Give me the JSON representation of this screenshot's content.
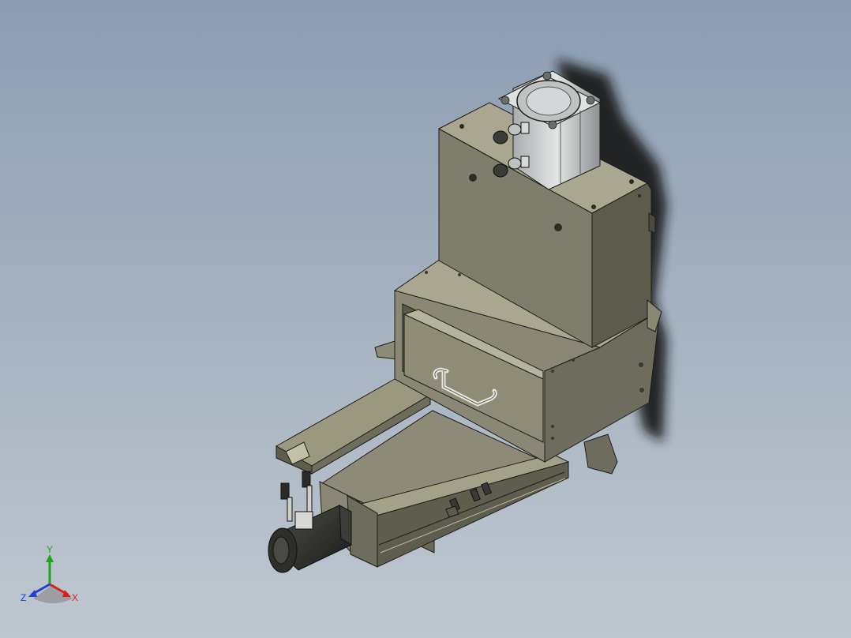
{
  "viewport": {
    "background_top": "#8c9db2",
    "background_bottom": "#bfc7cf"
  },
  "model": {
    "body_color": "#7f7d6b",
    "body_light": "#9a987f",
    "body_dark": "#5c5b4c",
    "edge_color": "#1e1e1a",
    "cylinder_color": "#c9cccc",
    "motor_color": "#2b2b29"
  },
  "triad": {
    "x_label": "X",
    "y_label": "Y",
    "z_label": "Z",
    "x_color": "#d62020",
    "y_color": "#1fa31f",
    "z_color": "#1f3fd6"
  }
}
